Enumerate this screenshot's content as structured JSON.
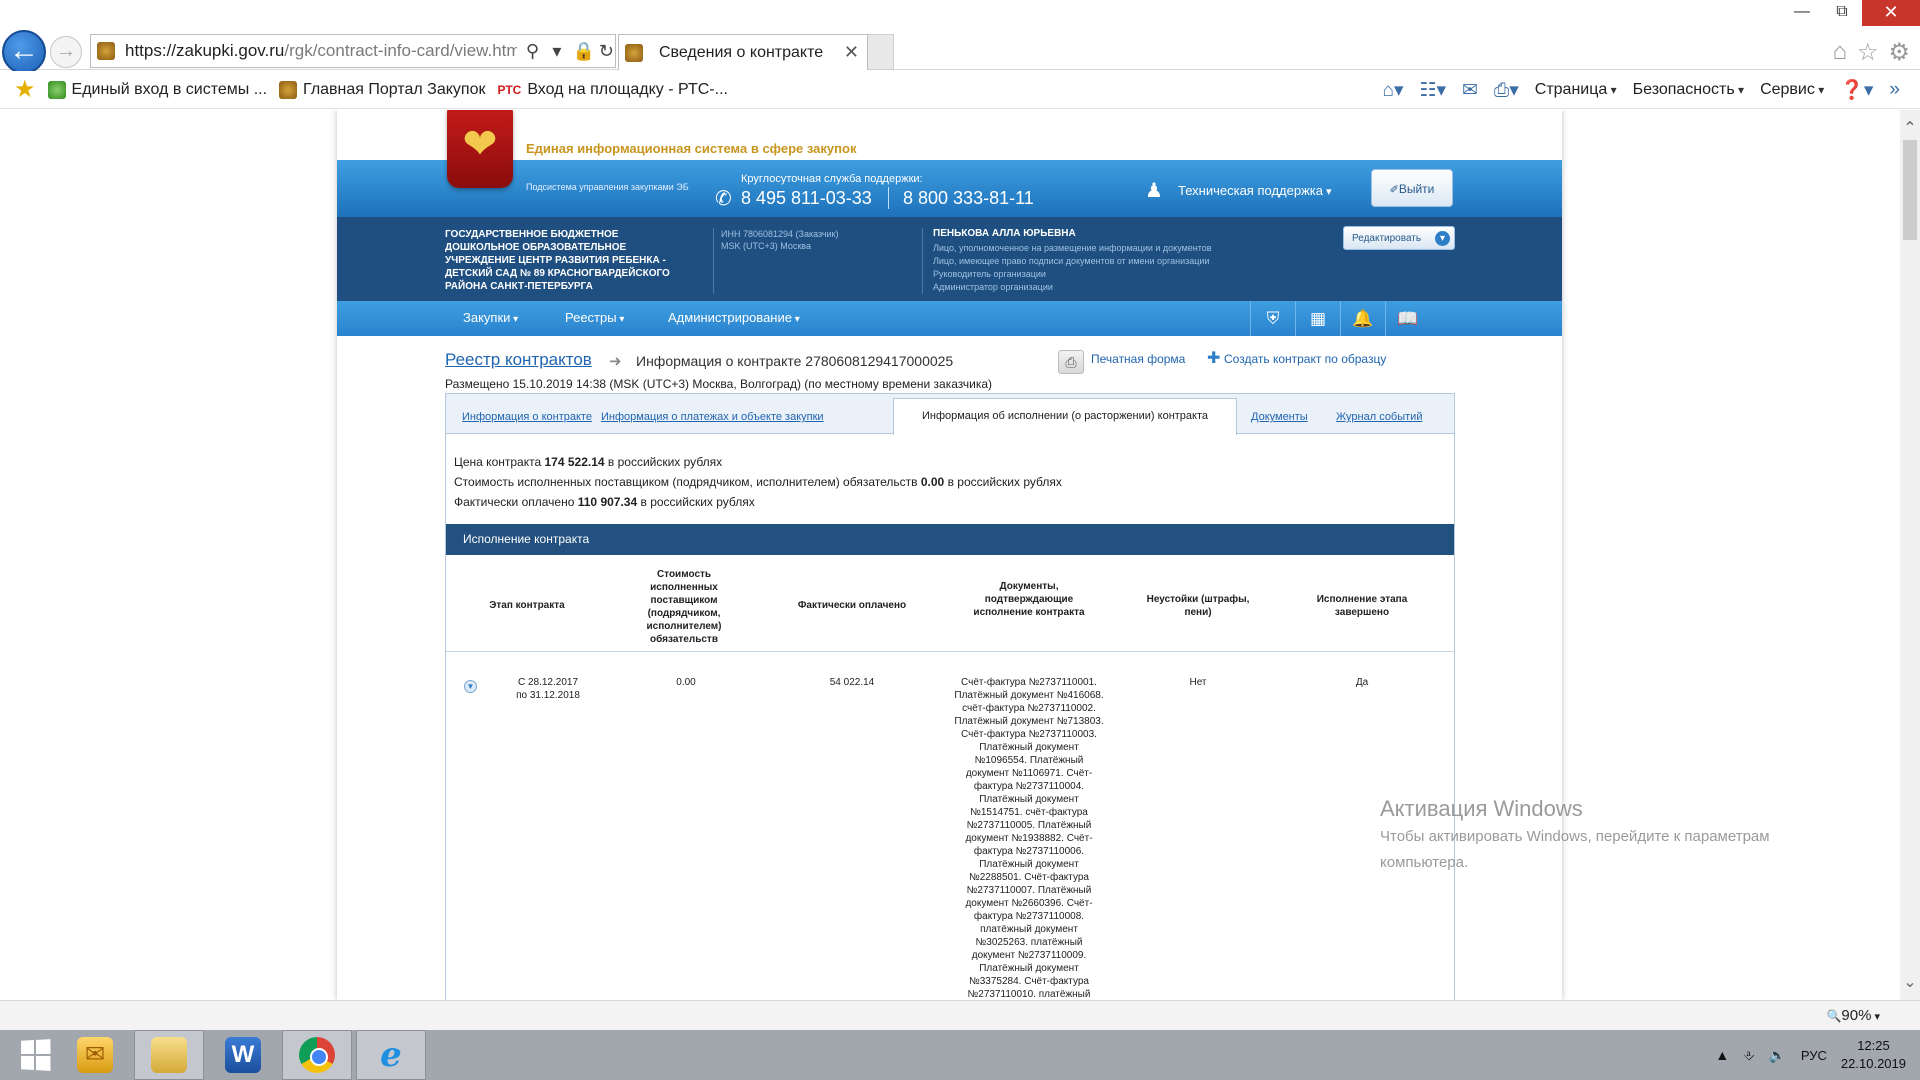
{
  "window": {
    "minimize_icon": "minimize-icon",
    "restore_icon": "restore-icon",
    "close_icon": "close-icon"
  },
  "browser": {
    "address": {
      "host": "https://zakupki.gov.ru",
      "path": "/rgk/contract-info-card/view.html?co"
    },
    "tab_title": "Сведения о контракте",
    "favorites": [
      {
        "label": "Единый вход в системы ...",
        "icon": "gosuslugi-icon"
      },
      {
        "label": "Главная Портал Закупок",
        "icon": "emblem-icon"
      },
      {
        "label": "Вход на площадку - РТС-...",
        "badge": "РТС"
      }
    ],
    "commands": [
      "Страница",
      "Безопасность",
      "Сервис"
    ],
    "zoom": "90%"
  },
  "site": {
    "title": "Единая информационная система в сфере закупок",
    "subsystem": "Подсистема управления закупками ЭБ",
    "support_label": "Круглосуточная служба поддержки:",
    "phone1": "8 495 811-03-33",
    "phone2": "8 800 333-81-11",
    "tech_support": "Техническая поддержка",
    "logout": "Выйти",
    "org": {
      "name": "ГОСУДАРСТВЕННОЕ БЮДЖЕТНОЕ ДОШКОЛЬНОЕ ОБРАЗОВАТЕЛЬНОЕ УЧРЕЖДЕНИЕ ЦЕНТР РАЗВИТИЯ РЕБЕНКА - ДЕТСКИЙ САД № 89 КРАСНОГВАРДЕЙСКОГО РАЙОНА САНКТ-ПЕТЕРБУРГА",
      "inn": "ИНН 7806081294 (Заказчик)",
      "tz": "MSK (UTC+3) Москва"
    },
    "user": {
      "name": "ПЕНЬКОВА АЛЛА ЮРЬЕВНА",
      "roles": [
        "Лицо, уполномоченное на размещение информации и документов",
        "Лицо, имеющее право подписи документов от имени организации",
        "Руководитель организации",
        "Администратор организации"
      ]
    },
    "edit": "Редактировать",
    "menu": [
      "Закупки",
      "Реестры",
      "Администрирование"
    ]
  },
  "content": {
    "breadcrumb_root": "Реестр контрактов",
    "breadcrumb_current": "Информация о контракте 2780608129417000025",
    "print": "Печатная форма",
    "create": "Создать контракт по образцу",
    "posted": "Размещено 15.10.2019 14:38 (MSK (UTC+3) Москва, Волгоград) (по местному времени заказчика)",
    "tabs": [
      "Информация о контракте",
      "Информация о платежах и объекте закупки",
      "Информация об исполнении (о расторжении) контракта",
      "Документы",
      "Журнал событий"
    ],
    "summary": {
      "price_prefix": "Цена контракта",
      "price": "174 522.14",
      "price_suffix": "в российских рублях",
      "fulfilled_prefix": "Стоимость исполненных поставщиком (подрядчиком, исполнителем) обязательств",
      "fulfilled": "0.00",
      "fulfilled_suffix": "в российских рублях",
      "paid_prefix": "Фактически оплачено",
      "paid": "110 907.34",
      "paid_suffix": "в российских рублях"
    },
    "section_title": "Исполнение контракта",
    "columns": [
      "Этап контракта",
      "Стоимость исполненных поставщиком (подрядчиком, исполнителем) обязательств",
      "Фактически оплачено",
      "Документы, подтверждающие исполнение контракта",
      "Неустойки (штрафы, пени)",
      "Исполнение этапа завершено"
    ],
    "row": {
      "stage_from": "С 28.12.2017",
      "stage_to": "по 31.12.2018",
      "fulfilled": "0.00",
      "paid": "54 022.14",
      "documents": "Счёт-фактура №2737110001. Платёжный документ №416068. счёт-фактура №2737110002. Платёжный документ №713803. Счёт-фактура №2737110003. Платёжный документ №1096554. Платёжный документ №1106971. Счёт-фактура №2737110004. Платёжный документ №1514751. счёт-фактура №2737110005. Платёжный документ №1938882. Счёт-фактура №2737110006. Платёжный документ №2288501. Счёт-фактура №2737110007. Платёжный документ №2660396. Счёт-фактура №2737110008. платёжный документ №3025263. платёжный документ №2737110009. Платёжный документ №3375284. Счёт-фактура №2737110010. платёжный",
      "penalties": "Нет",
      "completed": "Да"
    }
  },
  "watermark": {
    "title": "Активация Windows",
    "text": "Чтобы активировать Windows, перейдите к параметрам компьютера."
  },
  "taskbar": {
    "apps": [
      "windows-start-icon",
      "outlook-icon",
      "file-explorer-icon",
      "word-icon",
      "chrome-icon",
      "internet-explorer-icon"
    ],
    "lang": "РУС",
    "time": "12:25",
    "date": "22.10.2019"
  }
}
